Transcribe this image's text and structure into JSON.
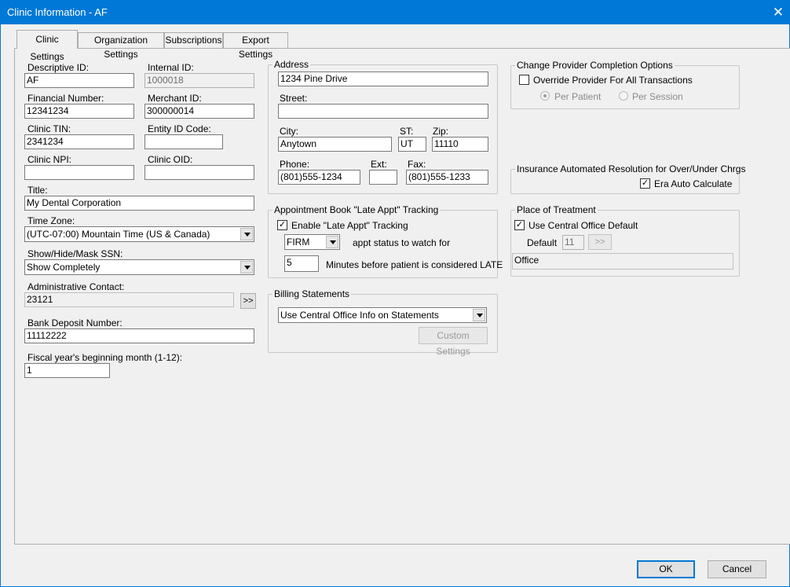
{
  "window": {
    "title": "Clinic Information - AF",
    "close_glyph": "✕"
  },
  "tabs": [
    "Clinic Settings",
    "Organization Settings",
    "Subscriptions",
    "Export Settings"
  ],
  "left": {
    "descriptive_id": {
      "label": "Descriptive ID:",
      "value": "AF"
    },
    "internal_id": {
      "label": "Internal ID:",
      "value": "1000018"
    },
    "financial_number": {
      "label": "Financial Number:",
      "value": "12341234"
    },
    "merchant_id": {
      "label": "Merchant ID:",
      "value": "300000014"
    },
    "clinic_tin": {
      "label": "Clinic TIN:",
      "value": "2341234"
    },
    "entity_id_code": {
      "label": "Entity ID Code:",
      "value": ""
    },
    "clinic_npi": {
      "label": "Clinic NPI:",
      "value": ""
    },
    "clinic_oid": {
      "label": "Clinic OID:",
      "value": ""
    },
    "title": {
      "label": "Title:",
      "value": "My Dental Corporation"
    },
    "time_zone": {
      "label": "Time Zone:",
      "value": "(UTC-07:00) Mountain Time (US & Canada)"
    },
    "ssn": {
      "label": "Show/Hide/Mask SSN:",
      "value": "Show Completely"
    },
    "admin_contact": {
      "label": "Administrative Contact:",
      "value": "23121",
      "button": ">>"
    },
    "bank_deposit": {
      "label": "Bank Deposit Number:",
      "value": "11112222"
    },
    "fiscal_year": {
      "label": "Fiscal year's beginning month (1-12):",
      "value": "1"
    }
  },
  "address": {
    "group_title": "Address",
    "line1": "1234 Pine Drive",
    "street_label": "Street:",
    "street": "",
    "city_label": "City:",
    "city": "Anytown",
    "st_label": "ST:",
    "st": "UT",
    "zip_label": "Zip:",
    "zip": "11110",
    "phone_label": "Phone:",
    "phone": "(801)555-1234",
    "ext_label": "Ext:",
    "ext": "",
    "fax_label": "Fax:",
    "fax": "(801)555-1233"
  },
  "late_appt": {
    "group_title": "Appointment Book \"Late Appt\" Tracking",
    "enable_label": "Enable \"Late Appt\" Tracking",
    "enabled": true,
    "status_value": "FIRM",
    "status_text": "appt status to watch for",
    "minutes_value": "5",
    "minutes_text": "Minutes before patient is considered LATE"
  },
  "billing": {
    "group_title": "Billing Statements",
    "select_value": "Use Central Office Info on Statements",
    "custom_button": "Custom Settings"
  },
  "provider_completion": {
    "group_title": "Change Provider Completion Options",
    "override_label": "Override Provider For All Transactions",
    "override_checked": false,
    "per_patient": "Per Patient",
    "per_session": "Per Session"
  },
  "insurance": {
    "group_title": "Insurance Automated Resolution for Over/Under Chrgs",
    "era_label": "Era Auto Calculate",
    "era_checked": true
  },
  "place_of_treatment": {
    "group_title": "Place of Treatment",
    "use_central_label": "Use Central Office Default",
    "use_central_checked": true,
    "default_label": "Default",
    "default_value": "11",
    "default_button": ">>",
    "description": "Office"
  },
  "footer": {
    "ok": "OK",
    "cancel": "Cancel"
  },
  "check_glyph": "✓"
}
